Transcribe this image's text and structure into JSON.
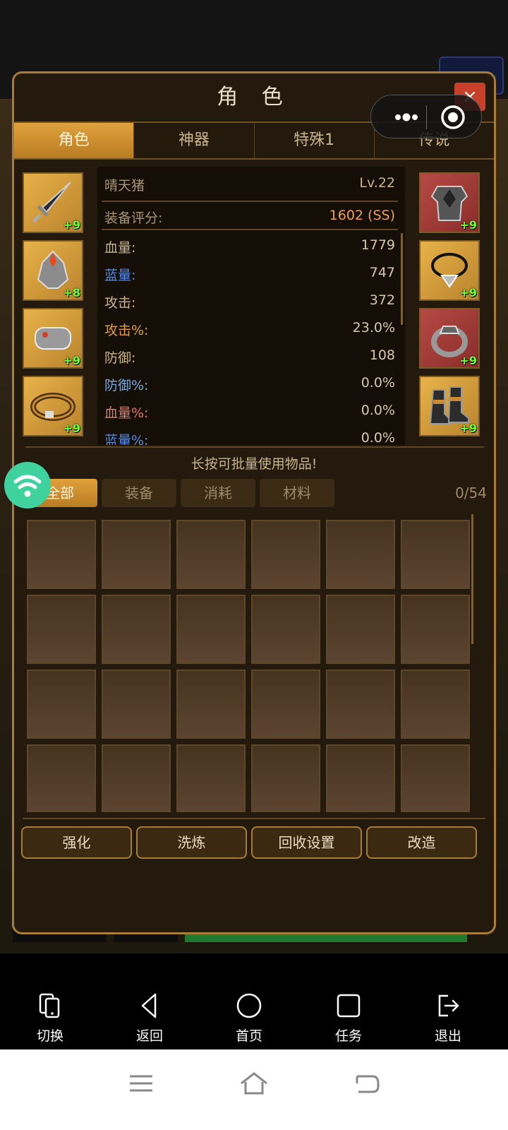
{
  "panel": {
    "title": "角 色",
    "close_label": "×",
    "tabs": [
      {
        "label": "角色",
        "active": true
      },
      {
        "label": "神器",
        "active": false
      },
      {
        "label": "特殊1",
        "active": false
      },
      {
        "label": "传说",
        "active": false
      }
    ]
  },
  "character": {
    "name": "晴天猪",
    "level": "Lv.22",
    "score_label": "装备评分:",
    "score_value": "1602 (SS)"
  },
  "stats": [
    {
      "label": "血量:",
      "value": "1779",
      "color": "#c9b48b"
    },
    {
      "label": "蓝量:",
      "value": "747",
      "color": "#5a8cdc"
    },
    {
      "label": "攻击:",
      "value": "372",
      "color": "#c9b48b"
    },
    {
      "label": "攻击%:",
      "value": "23.0%",
      "color": "#e0a040"
    },
    {
      "label": "防御:",
      "value": "108",
      "color": "#c9b48b"
    },
    {
      "label": "防御%:",
      "value": "0.0%",
      "color": "#7aa8d8"
    },
    {
      "label": "血量%:",
      "value": "0.0%",
      "color": "#e07a6a"
    },
    {
      "label": "蓝量%:",
      "value": "0.0%",
      "color": "#5a8cdc"
    }
  ],
  "equipment_left": [
    {
      "icon": "sword-icon",
      "plus": "+9"
    },
    {
      "icon": "helmet-icon",
      "plus": "+8"
    },
    {
      "icon": "bracer-icon",
      "plus": "+9"
    },
    {
      "icon": "belt-icon",
      "plus": "+9"
    }
  ],
  "equipment_right": [
    {
      "icon": "armor-icon",
      "plus": "+9"
    },
    {
      "icon": "necklace-icon",
      "plus": "+9"
    },
    {
      "icon": "ring-icon",
      "plus": "+9"
    },
    {
      "icon": "boots-icon",
      "plus": "+9"
    }
  ],
  "inventory": {
    "hint": "长按可批量使用物品!",
    "filters": [
      {
        "label": "全部",
        "active": true
      },
      {
        "label": "装备",
        "active": false
      },
      {
        "label": "消耗",
        "active": false
      },
      {
        "label": "材料",
        "active": false
      }
    ],
    "count": "0/54"
  },
  "actions": [
    "强化",
    "洗炼",
    "回收设置",
    "改造"
  ],
  "nav": [
    {
      "label": "切换",
      "icon": "phone-switch-icon"
    },
    {
      "label": "返回",
      "icon": "back-triangle-icon"
    },
    {
      "label": "首页",
      "icon": "home-circle-icon"
    },
    {
      "label": "任务",
      "icon": "task-square-icon"
    },
    {
      "label": "退出",
      "icon": "exit-icon"
    }
  ],
  "colors": {
    "accent": "#d99530",
    "score": "#f0a050",
    "plus": "#6bff3b"
  }
}
